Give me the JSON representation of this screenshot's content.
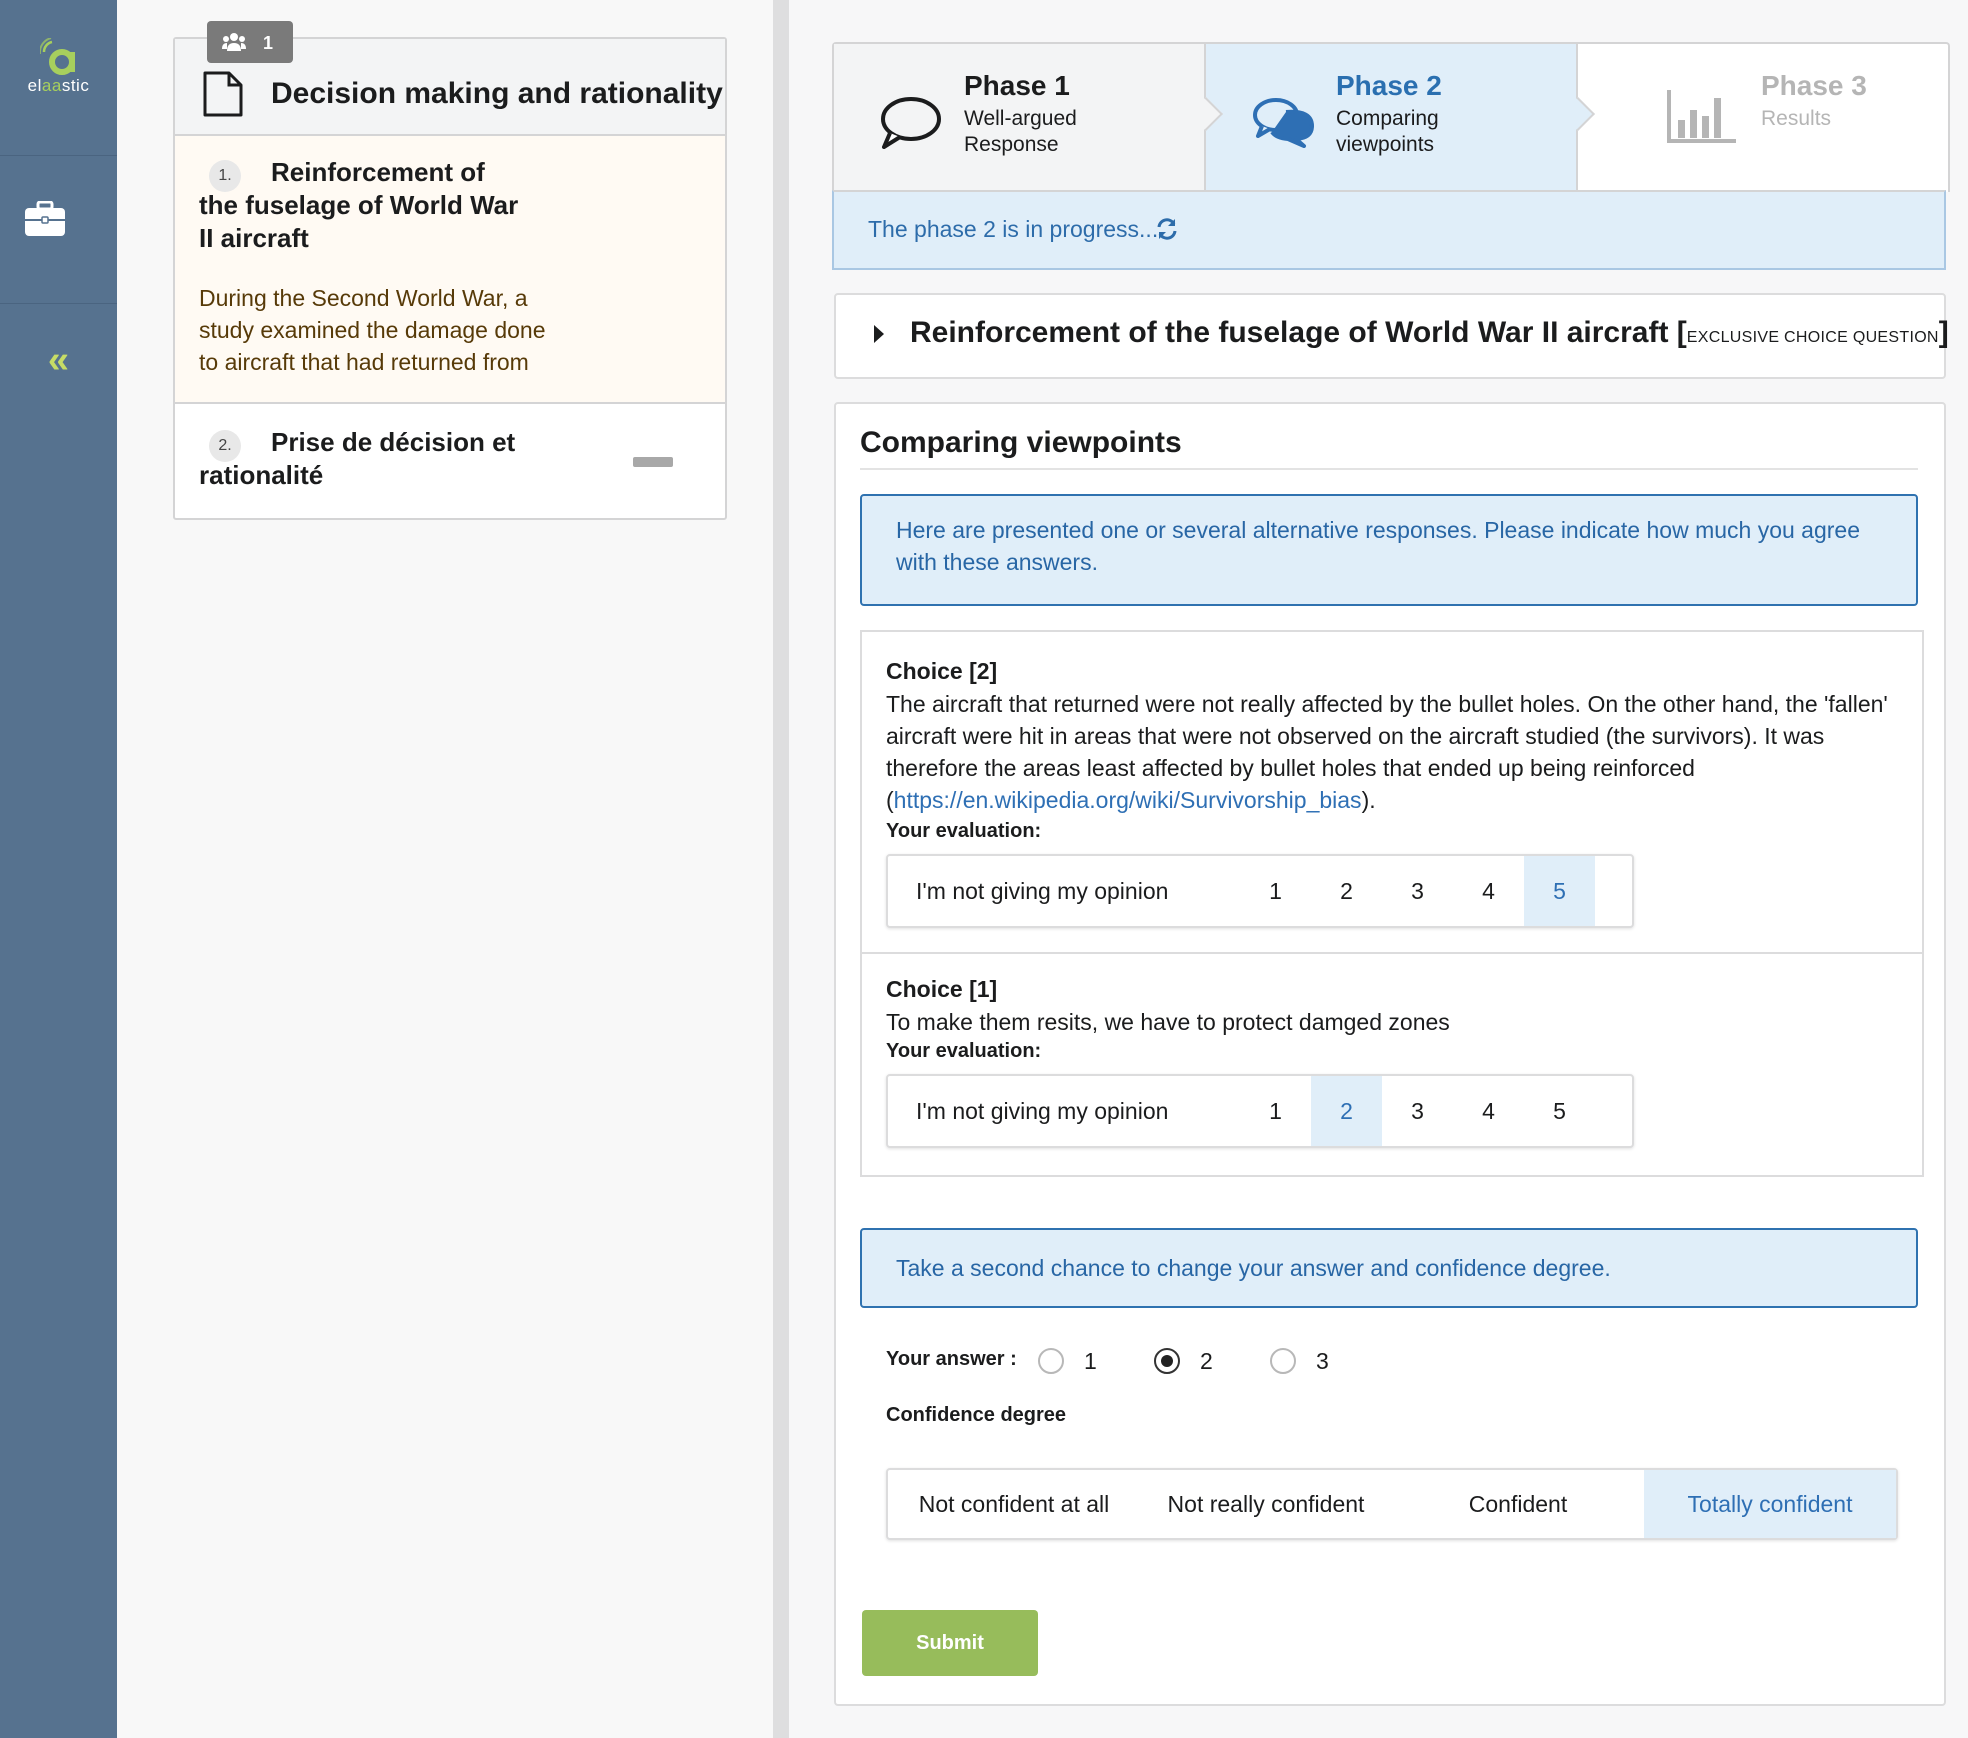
{
  "brand": {
    "logo_text_prefix": "el",
    "logo_text_accent": "aa",
    "logo_text_suffix": "stic"
  },
  "sidebar": {
    "icons": [
      "briefcase-icon",
      "double-chevron-left-icon"
    ]
  },
  "sequence": {
    "learners_count": "1",
    "title": "Decision making and rationality",
    "items": [
      {
        "number": "1.",
        "title": "Reinforcement of the fuselage of World War II aircraft",
        "description": "During the Second World War, a study examined the damage done to aircraft that had returned from"
      },
      {
        "number": "2.",
        "title": "Prise de décision et rationalité"
      }
    ]
  },
  "phases": [
    {
      "title": "Phase 1",
      "subtitle": "Well-argued Response",
      "icon": "speech-bubble-icon"
    },
    {
      "title": "Phase 2",
      "subtitle": "Comparing viewpoints",
      "icon": "chat-bubbles-icon"
    },
    {
      "title": "Phase 3",
      "subtitle": "Results",
      "icon": "bar-chart-icon"
    }
  ],
  "status": {
    "message": "The phase 2 is in progress...",
    "icon": "refresh-icon"
  },
  "question": {
    "title": "Reinforcement of the fuselage of World War II aircraft",
    "bracket_open": "[",
    "type": "EXCLUSIVE CHOICE QUESTION",
    "bracket_close": "]"
  },
  "comparing": {
    "title": "Comparing viewpoints",
    "instructions": "Here are presented one or several alternative responses. Please indicate how much you agree with these answers.",
    "evaluation_label": "Your evaluation:",
    "scale_options": [
      "I'm not giving my opinion",
      "1",
      "2",
      "3",
      "4",
      "5"
    ],
    "choices": [
      {
        "title": "Choice [2]",
        "text": "The aircraft that returned were not really affected by the bullet holes. On the other hand, the 'fallen' aircraft were hit in areas that were not observed on the aircraft studied (the survivors). It was therefore the areas least affected by bullet holes that ended up being reinforced",
        "link_prefix": " (",
        "link": "https://en.wikipedia.org/wiki/Survivorship_bias",
        "link_suffix": ").",
        "selected": "5"
      },
      {
        "title": "Choice [1]",
        "text": "To make them resits, we have to protect damged zones",
        "selected": "2"
      }
    ],
    "second_chance": "Take a second chance to change your answer and confidence degree.",
    "answer_label": "Your answer :",
    "answer_options": [
      "1",
      "2",
      "3"
    ],
    "answer_selected": "2",
    "confidence_label": "Confidence degree",
    "confidence_options": [
      "Not confident at all",
      "Not really confident",
      "Confident",
      "Totally confident"
    ],
    "confidence_selected": "Totally confident",
    "submit_label": "Submit"
  },
  "colors": {
    "rail": "#56728f",
    "accent_blue": "#2e6fb4",
    "selected_bg": "#e0eef9",
    "submit_green": "#97bc5b",
    "logo_green": "#a7cf5d"
  }
}
